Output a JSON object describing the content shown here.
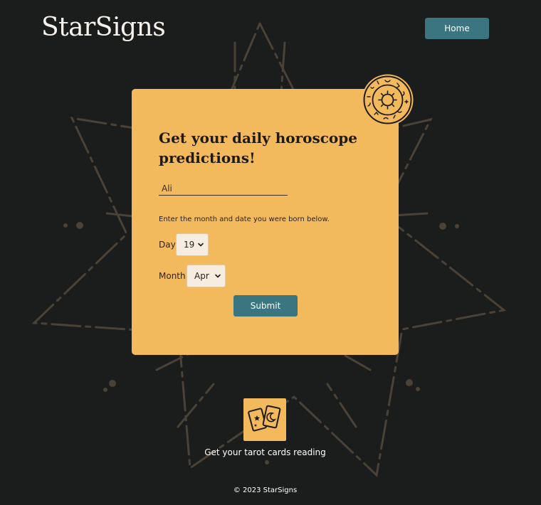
{
  "brand": {
    "logo_text": "StarSigns"
  },
  "nav": {
    "home_label": "Home"
  },
  "form": {
    "title": "Get your daily horoscope predictions!",
    "name_value": "Ali",
    "instructions": "Enter the month and date you were born below.",
    "day_label": "Day:",
    "day_value": "19",
    "month_label": "Month:",
    "month_value": "Apr",
    "submit_label": "Submit"
  },
  "tarot": {
    "icon": "tarot-cards-icon",
    "link_label": "Get your tarot cards reading"
  },
  "footer": {
    "copyright": "© 2023 StarSigns"
  },
  "colors": {
    "background": "#1b1c1c",
    "card": "#f3b95d",
    "button": "#3a7580",
    "star_outline": "#4a4236"
  },
  "icons": {
    "background": "star-outline-background",
    "zodiac_badge": "zodiac-wheel-icon",
    "select_arrow": "chevron-down-icon"
  }
}
